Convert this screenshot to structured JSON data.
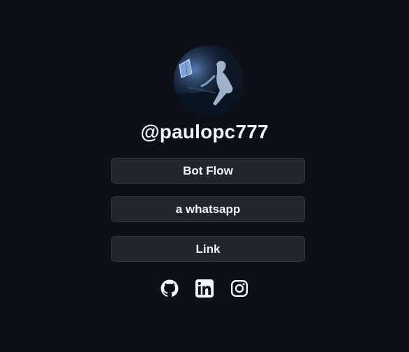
{
  "profile": {
    "username": "@paulopc777",
    "avatar_icon": "profile-avatar-photo"
  },
  "links": [
    {
      "label": "Bot Flow"
    },
    {
      "label": "a whatsapp"
    },
    {
      "label": "Link"
    }
  ],
  "socials": [
    {
      "icon": "github-icon"
    },
    {
      "icon": "linkedin-icon"
    },
    {
      "icon": "instagram-icon"
    }
  ],
  "colors": {
    "background": "#0d1117",
    "button_bg": "#21262d",
    "button_border": "#30363d",
    "text": "#f0f6fc"
  }
}
